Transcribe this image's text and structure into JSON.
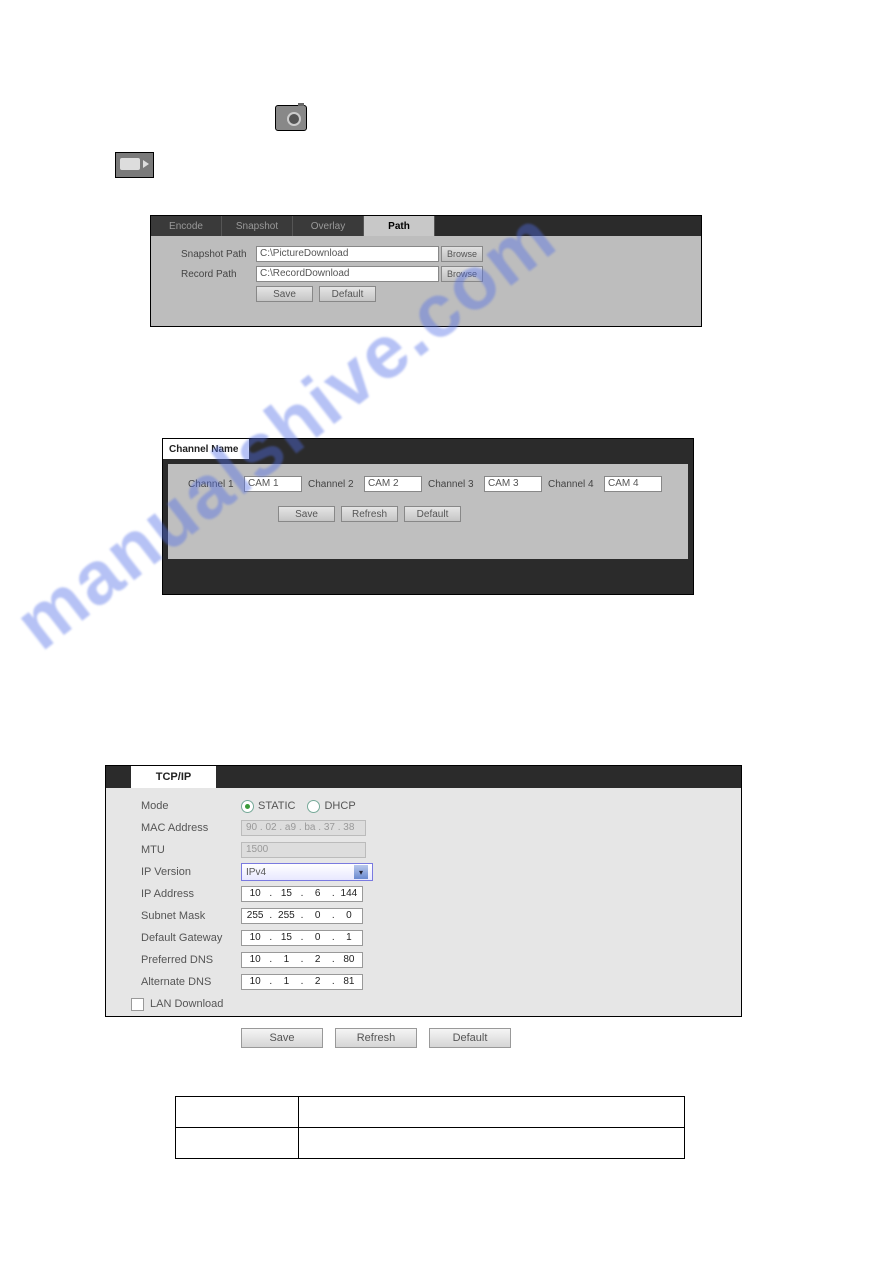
{
  "watermark": "manualshive.com",
  "path_panel": {
    "tabs": {
      "encode": "Encode",
      "snapshot": "Snapshot",
      "overlay": "Overlay",
      "path": "Path"
    },
    "snapshot_label": "Snapshot Path",
    "snapshot_value": "C:\\PictureDownload",
    "record_label": "Record Path",
    "record_value": "C:\\RecordDownload",
    "browse": "Browse",
    "save": "Save",
    "default": "Default"
  },
  "channel_panel": {
    "tab": "Channel Name",
    "channels": [
      {
        "label": "Channel 1",
        "value": "CAM 1"
      },
      {
        "label": "Channel 2",
        "value": "CAM 2"
      },
      {
        "label": "Channel 3",
        "value": "CAM 3"
      },
      {
        "label": "Channel 4",
        "value": "CAM 4"
      }
    ],
    "save": "Save",
    "refresh": "Refresh",
    "default": "Default"
  },
  "tcpip": {
    "tab": "TCP/IP",
    "mode_label": "Mode",
    "mode_static": "STATIC",
    "mode_dhcp": "DHCP",
    "mac_label": "MAC Address",
    "mac_value": "90 . 02 . a9 . ba . 37 . 38",
    "mtu_label": "MTU",
    "mtu_value": "1500",
    "ipver_label": "IP Version",
    "ipver_value": "IPv4",
    "ip_label": "IP Address",
    "ip": [
      "10",
      "15",
      "6",
      "144"
    ],
    "mask_label": "Subnet Mask",
    "mask": [
      "255",
      "255",
      "0",
      "0"
    ],
    "gw_label": "Default Gateway",
    "gw": [
      "10",
      "15",
      "0",
      "1"
    ],
    "pdns_label": "Preferred DNS",
    "pdns": [
      "10",
      "1",
      "2",
      "80"
    ],
    "adns_label": "Alternate DNS",
    "adns": [
      "10",
      "1",
      "2",
      "81"
    ],
    "lan_dl": "LAN Download",
    "save": "Save",
    "refresh": "Refresh",
    "default": "Default"
  }
}
